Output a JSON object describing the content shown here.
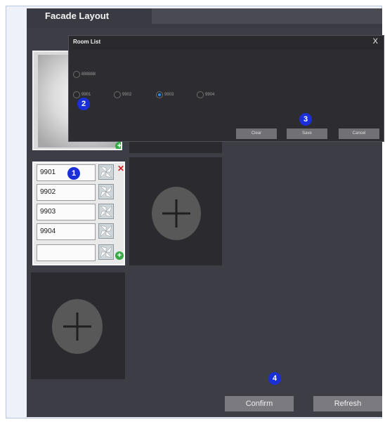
{
  "window": {
    "title": "Facade Layout"
  },
  "rooms": {
    "items": [
      {
        "label": "9901"
      },
      {
        "label": "9902"
      },
      {
        "label": "9903"
      },
      {
        "label": "9904"
      },
      {
        "label": ""
      }
    ]
  },
  "dialog": {
    "title": "Room List",
    "close_label": "X",
    "options": [
      {
        "label": "888888",
        "selected": false
      },
      {
        "label": "9901",
        "selected": false
      },
      {
        "label": "9902",
        "selected": false
      },
      {
        "label": "9903",
        "selected": true
      },
      {
        "label": "9904",
        "selected": false
      }
    ],
    "buttons": {
      "clear": "Clear",
      "save": "Save",
      "cancel": "Cancel"
    }
  },
  "footer": {
    "confirm": "Confirm",
    "refresh": "Refresh"
  },
  "annotations": [
    "1",
    "2",
    "3",
    "4"
  ],
  "icons": {
    "add": "plus-icon",
    "delete": "close-icon",
    "room_tile": "pinwheel-icon",
    "add_room": "green-plus-icon"
  },
  "colors": {
    "badge": "#1b2fd6",
    "selected_radio": "#1e90ff",
    "delete": "#d41e1e",
    "add_green": "#36a844"
  }
}
